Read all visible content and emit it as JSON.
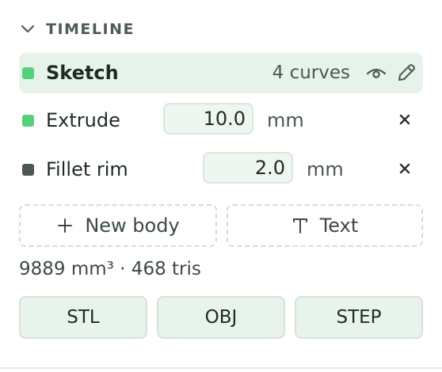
{
  "colors": {
    "accent_green": "#55d17a",
    "muted_dark": "#4b574f",
    "sketch_row_bg": "#e7f3ea",
    "button_bg": "#e8f3eb"
  },
  "timeline": {
    "title": "TIMELINE",
    "collapse_icon": "chevron-down-icon",
    "items": [
      {
        "name": "Sketch",
        "meta": "4 curves",
        "status_color": "#55d17a",
        "icons": [
          "eye-icon",
          "pencil-icon"
        ]
      },
      {
        "name": "Extrude",
        "value": "10.0",
        "unit": "mm",
        "status_color": "#55d17a",
        "remove_icon": "close-icon"
      },
      {
        "name": "Fillet rim",
        "value": "2.0",
        "unit": "mm",
        "status_color": "#4b574f",
        "remove_icon": "close-icon"
      }
    ]
  },
  "actions": {
    "new_body": {
      "label": "New body",
      "icon": "plus-icon"
    },
    "text": {
      "label": "Text",
      "icon": "text-icon"
    }
  },
  "stats": "9889 mm³ · 468 tris",
  "export": {
    "stl": "STL",
    "obj": "OBJ",
    "step": "STEP"
  }
}
